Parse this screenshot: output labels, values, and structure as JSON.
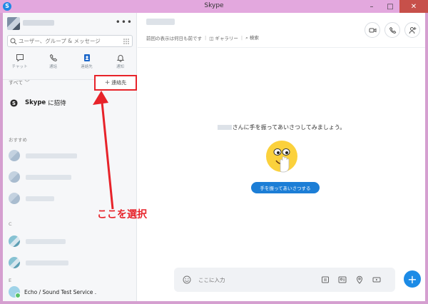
{
  "window": {
    "title": "Skype"
  },
  "sidebar": {
    "search_placeholder": "ユーザー、グループ & メッセージ",
    "tabs": [
      {
        "label": "チャット",
        "icon": "chat-icon",
        "active": false
      },
      {
        "label": "通話",
        "icon": "phone-icon",
        "active": false
      },
      {
        "label": "連絡先",
        "icon": "contacts-icon",
        "active": true
      },
      {
        "label": "通知",
        "icon": "bell-icon",
        "active": false
      }
    ],
    "filter_label": "すべて",
    "add_contact_label": "連絡先",
    "invite": {
      "brand": "Skype",
      "text": "に招待"
    },
    "sections": {
      "recommended": "おすすめ",
      "c": "C",
      "e": "E"
    },
    "echo_contact": "Echo / Sound Test Service ."
  },
  "main": {
    "subinfo": {
      "last_seen": "前回の表示は何日も前です",
      "gallery": "ギャラリー",
      "search": "検索"
    },
    "greeting_suffix": "さんに手を振ってあいさつしてみましょう。",
    "wave_button": "手を振ってあいさつする",
    "composer_placeholder": "ここに入力"
  },
  "annotation": {
    "text": "ここを選択",
    "color": "#e7232a"
  },
  "colors": {
    "accent": "#1c7ed6",
    "highlight": "#e7232a",
    "titlebar": "#e3a8de"
  }
}
